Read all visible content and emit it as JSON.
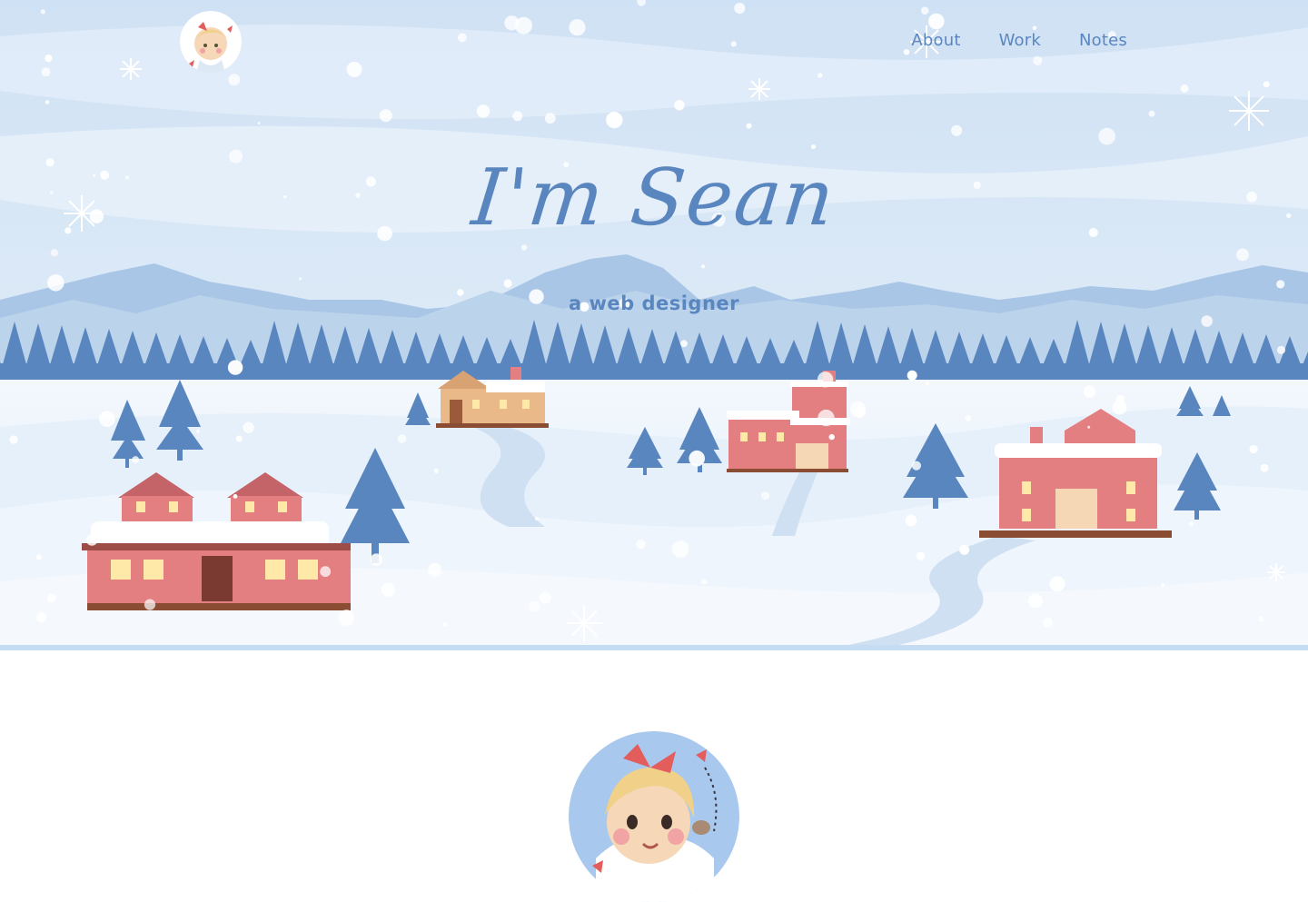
{
  "nav": {
    "items": [
      {
        "label": "About"
      },
      {
        "label": "Work"
      },
      {
        "label": "Notes"
      }
    ]
  },
  "hero": {
    "title": "I'm Sean",
    "subtitle": "a web designer"
  },
  "colors": {
    "accent": "#5a86bf",
    "sky": "#d6e6f6",
    "snow": "#eef5fc",
    "house": "#e37f80",
    "tree": "#5a86bf"
  },
  "icons": {
    "logo": "girl-avatar-icon",
    "snowflake": "snowflake-icon"
  }
}
